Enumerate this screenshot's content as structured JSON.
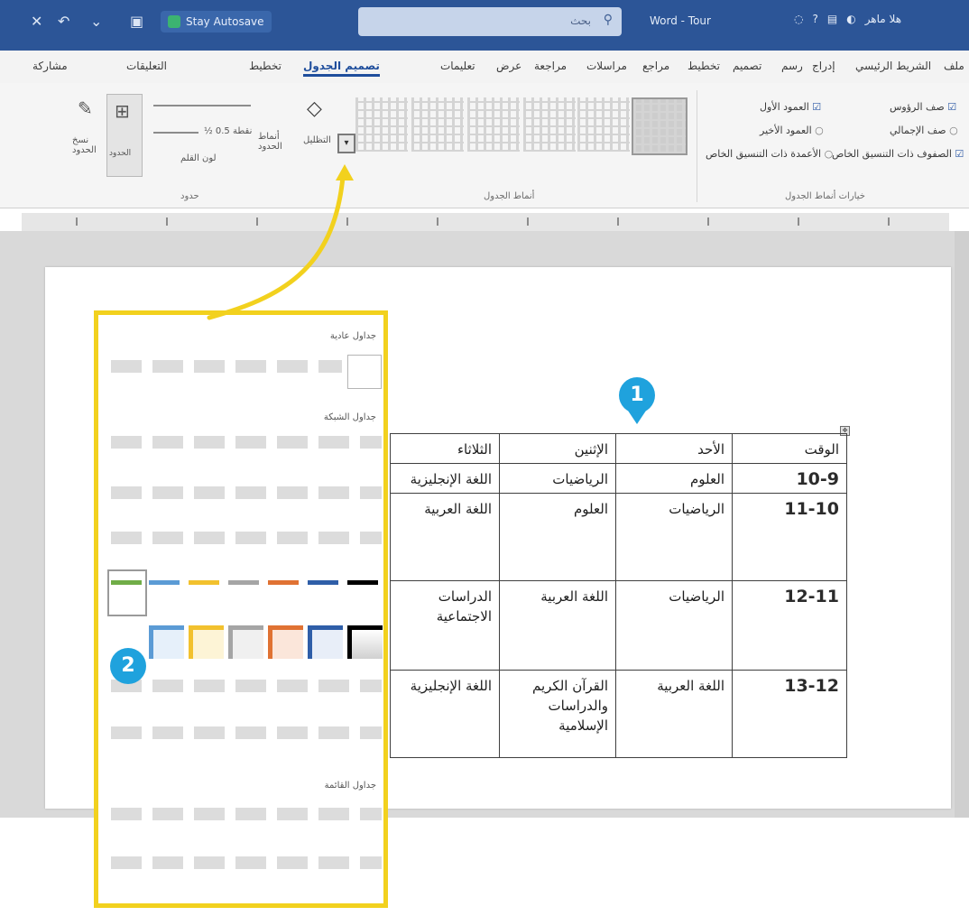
{
  "window": {
    "autosave_label": "Stay Autosave",
    "search_placeholder": "بحث",
    "document_title": "Word - Tour",
    "account_label": "هلا ماهر"
  },
  "ribbon_tabs": [
    {
      "label": "ملف"
    },
    {
      "label": "الشريط الرئيسي"
    },
    {
      "label": "إدراج"
    },
    {
      "label": "رسم"
    },
    {
      "label": "تصميم"
    },
    {
      "label": "تخطيط"
    },
    {
      "label": "مراجع"
    },
    {
      "label": "مراسلات"
    },
    {
      "label": "مراجعة"
    },
    {
      "label": "عرض"
    },
    {
      "label": "تعليمات"
    },
    {
      "label": "تصميم الجدول"
    },
    {
      "label": "تخطيط"
    }
  ],
  "ribbon_right": {
    "comments_label": "التعليقات",
    "share_label": "مشاركة"
  },
  "ribbon": {
    "options": {
      "header_row": "صف الرؤوس",
      "total_row": "صف الإجمالي",
      "banded_rows": "الصفوف ذات التنسيق الخاص",
      "first_column": "العمود الأول",
      "last_column": "العمود الأخير",
      "banded_columns": "الأعمدة ذات التنسيق الخاص",
      "group_label": "خيارات أنماط الجدول"
    },
    "styles_group_label": "أنماط الجدول",
    "shading_label": "التظليل",
    "border_styles_label": "أنماط الحدود",
    "pen_weight_label": "½ 0.5 نقطة",
    "pen_color_label": "لون القلم",
    "borders_group_label": "حدود",
    "borders_button_label": "الحدود",
    "painter_label": "نسخ الحدود"
  },
  "table": {
    "headers": [
      "الوقت",
      "الأحد",
      "الإثنين",
      "الثلاثاء"
    ],
    "rows": [
      {
        "time": "10-9",
        "cells": [
          "العلوم",
          "الرياضيات",
          "اللغة الإنجليزية"
        ]
      },
      {
        "time": "11-10",
        "cells": [
          "الرياضيات",
          "العلوم",
          "اللغة العربية"
        ]
      },
      {
        "time": "12-11",
        "cells": [
          "الرياضيات",
          "اللغة العربية",
          "الدراسات الاجتماعية"
        ]
      },
      {
        "time": "13-12",
        "cells": [
          "اللغة العربية",
          "القرآن الكريم والدراسات الإسلامية",
          "اللغة الإنجليزية"
        ]
      }
    ]
  },
  "badges": {
    "one": "1",
    "two": "2"
  },
  "gallery": {
    "plain_tables_label": "جداول عادية",
    "grid_tables_label": "جداول الشبكة",
    "list_tables_label": "جداول القائمة",
    "accent_colors": [
      "#000000",
      "#2f5ea8",
      "#e07233",
      "#a5a5a5",
      "#f2c12e",
      "#5b9bd5",
      "#70ad47"
    ]
  },
  "colors": {
    "title_bar": "#2c5597",
    "highlight": "#f2d11e",
    "badge": "#1fa2dd"
  }
}
